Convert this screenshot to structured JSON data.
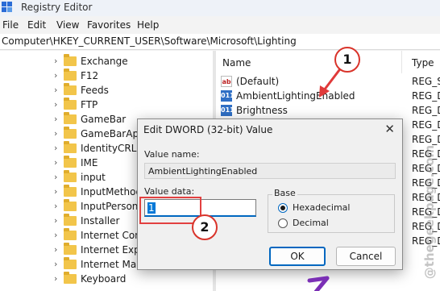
{
  "window": {
    "title": "Registry Editor"
  },
  "menu": [
    "File",
    "Edit",
    "View",
    "Favorites",
    "Help"
  ],
  "address": "Computer\\HKEY_CURRENT_USER\\Software\\Microsoft\\Lighting",
  "tree": {
    "items": [
      {
        "label": "Exchange"
      },
      {
        "label": "F12"
      },
      {
        "label": "Feeds"
      },
      {
        "label": "FTP"
      },
      {
        "label": "GameBar"
      },
      {
        "label": "GameBarApi"
      },
      {
        "label": "IdentityCRL"
      },
      {
        "label": "IME"
      },
      {
        "label": "input"
      },
      {
        "label": "InputMethod"
      },
      {
        "label": "InputPersona"
      },
      {
        "label": "Installer"
      },
      {
        "label": "Internet Conn"
      },
      {
        "label": "Internet Explo"
      },
      {
        "label": "Internet Mail"
      },
      {
        "label": "Keyboard"
      }
    ]
  },
  "list": {
    "columns": {
      "name": "Name",
      "type": "Type"
    },
    "rows": [
      {
        "icon": "ab",
        "name": "(Default)",
        "type": "REG_SZ"
      },
      {
        "icon": "011",
        "name": "AmbientLightingEnabled",
        "type": "REG_DWORD"
      },
      {
        "icon": "011",
        "name": "Brightness",
        "type": "REG_DW"
      }
    ],
    "extra_types": [
      "REG_DW",
      "REG_DW",
      "REG_DW",
      "REG_DW",
      "REG_DW",
      "REG_DW",
      "REG_DW",
      "REG_DW",
      "REG_DW"
    ]
  },
  "dialog": {
    "title": "Edit DWORD (32-bit) Value",
    "value_name_label": "Value name:",
    "value_name": "AmbientLightingEnabled",
    "value_data_label": "Value data:",
    "value_data": "1",
    "base_label": "Base",
    "hex_label": "Hexadecimal",
    "dec_label": "Decimal",
    "selected_base": "Hexadecimal",
    "ok_label": "OK",
    "cancel_label": "Cancel"
  },
  "annotations": {
    "step1": "1",
    "step2": "2"
  },
  "watermark": "@thegeekpage.com",
  "colors": {
    "accent": "#0067c0",
    "annotation_red": "#d9342b",
    "arrow_red": "#e03a3a",
    "arrow_purple": "#7a2fb5"
  }
}
